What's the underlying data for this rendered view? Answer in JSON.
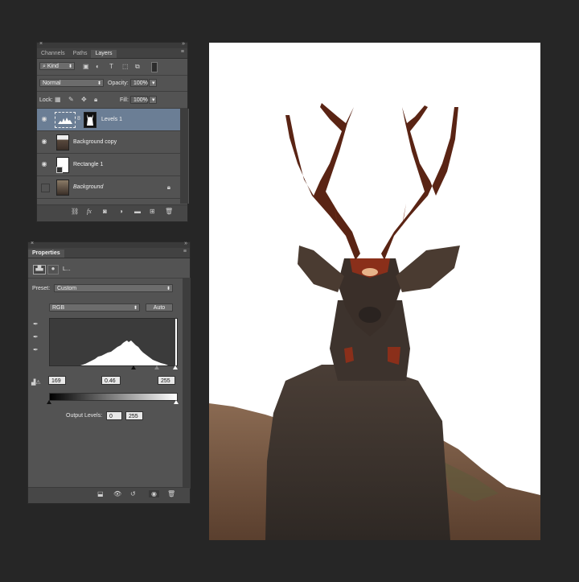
{
  "layers_panel": {
    "tabs": [
      "Channels",
      "Paths",
      "Layers"
    ],
    "active_tab": "Layers",
    "filter_kind": "Kind",
    "blend_mode": "Normal",
    "opacity_label": "Opacity:",
    "opacity_value": "100%",
    "lock_label": "Lock:",
    "fill_label": "Fill:",
    "fill_value": "100%",
    "layers": [
      {
        "name": "Levels 1",
        "selected": true,
        "visible": true
      },
      {
        "name": "Background copy",
        "selected": false,
        "visible": true
      },
      {
        "name": "Rectangle 1",
        "selected": false,
        "visible": true
      },
      {
        "name": "Background",
        "selected": false,
        "visible": false
      }
    ],
    "fx_label": "fx"
  },
  "properties_panel": {
    "tab": "Properties",
    "adjustment_short": "L...",
    "preset_label": "Preset:",
    "preset_value": "Custom",
    "channel_value": "RGB",
    "auto_button": "Auto",
    "input_black": "169",
    "input_gamma": "0.46",
    "input_white": "255",
    "output_label": "Output Levels:",
    "output_black": "0",
    "output_white": "255"
  },
  "colors": {
    "panel_bg": "#535353",
    "selected_layer": "#6b7e95",
    "app_bg": "#262626"
  }
}
